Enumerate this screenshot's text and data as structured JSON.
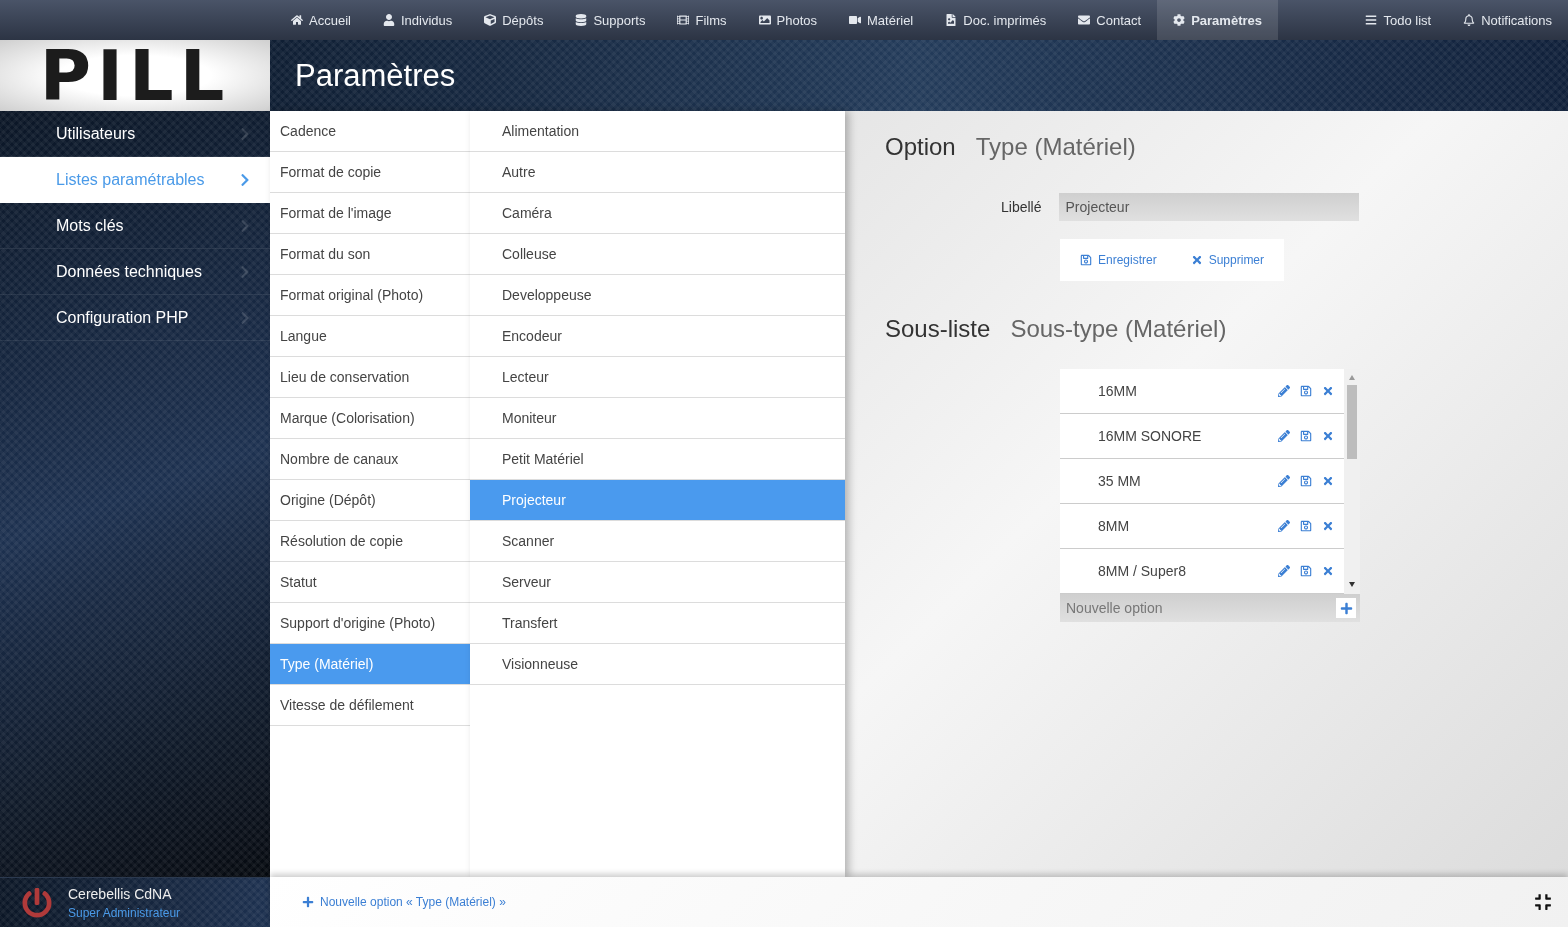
{
  "nav": {
    "items": [
      {
        "label": "Accueil",
        "selected": false
      },
      {
        "label": "Individus",
        "selected": false
      },
      {
        "label": "Dépôts",
        "selected": false
      },
      {
        "label": "Supports",
        "selected": false
      },
      {
        "label": "Films",
        "selected": false
      },
      {
        "label": "Photos",
        "selected": false
      },
      {
        "label": "Matériel",
        "selected": false
      },
      {
        "label": "Doc. imprimés",
        "selected": false
      },
      {
        "label": "Contact",
        "selected": false
      },
      {
        "label": "Paramètres",
        "selected": true
      }
    ],
    "right_items": [
      "Todo list",
      "Notifications"
    ]
  },
  "logo": "PILL",
  "page_title": "Paramètres",
  "sidebar": {
    "items": [
      {
        "label": "Utilisateurs",
        "selected": false
      },
      {
        "label": "Listes paramétrables",
        "selected": true
      },
      {
        "label": "Mots clés",
        "selected": false
      },
      {
        "label": "Données techniques",
        "selected": false
      },
      {
        "label": "Configuration PHP",
        "selected": false
      }
    ]
  },
  "lists": [
    {
      "label": "Cadence",
      "selected": false
    },
    {
      "label": "Format de copie",
      "selected": false
    },
    {
      "label": "Format de l'image",
      "selected": false
    },
    {
      "label": "Format du son",
      "selected": false
    },
    {
      "label": "Format original (Photo)",
      "selected": false
    },
    {
      "label": "Langue",
      "selected": false
    },
    {
      "label": "Lieu de conservation",
      "selected": false
    },
    {
      "label": "Marque (Colorisation)",
      "selected": false
    },
    {
      "label": "Nombre de canaux",
      "selected": false
    },
    {
      "label": "Origine (Dépôt)",
      "selected": false
    },
    {
      "label": "Résolution de copie",
      "selected": false
    },
    {
      "label": "Statut",
      "selected": false
    },
    {
      "label": "Support d'origine (Photo)",
      "selected": false
    },
    {
      "label": "Type (Matériel)",
      "selected": true
    },
    {
      "label": "Vitesse de défilement",
      "selected": false
    }
  ],
  "options": [
    {
      "label": "Alimentation",
      "selected": false
    },
    {
      "label": "Autre",
      "selected": false
    },
    {
      "label": "Caméra",
      "selected": false
    },
    {
      "label": "Colleuse",
      "selected": false
    },
    {
      "label": "Developpeuse",
      "selected": false
    },
    {
      "label": "Encodeur",
      "selected": false
    },
    {
      "label": "Lecteur",
      "selected": false
    },
    {
      "label": "Moniteur",
      "selected": false
    },
    {
      "label": "Petit Matériel",
      "selected": false
    },
    {
      "label": "Projecteur",
      "selected": true
    },
    {
      "label": "Scanner",
      "selected": false
    },
    {
      "label": "Serveur",
      "selected": false
    },
    {
      "label": "Transfert",
      "selected": false
    },
    {
      "label": "Visionneuse",
      "selected": false
    }
  ],
  "option_panel": {
    "heading": "Option",
    "title": "Type (Matériel)",
    "field_label": "Libellé",
    "field_value": "Projecteur",
    "save": "Enregistrer",
    "delete": "Supprimer"
  },
  "sublist": {
    "heading": "Sous-liste",
    "title": "Sous-type (Matériel)",
    "rows": [
      "16MM",
      "16MM SONORE",
      "35 MM",
      "8MM",
      "8MM / Super8"
    ],
    "new_placeholder": "Nouvelle option"
  },
  "footer": {
    "user": "Cerebellis CdNA",
    "role": "Super Administrateur",
    "action": "Nouvelle option « Type (Matériel) »"
  }
}
